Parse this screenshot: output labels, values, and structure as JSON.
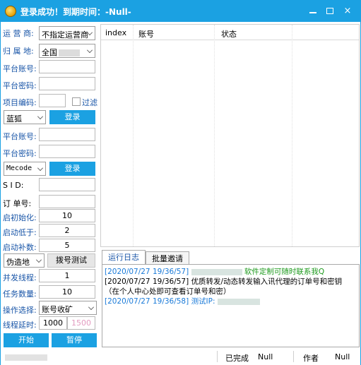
{
  "window": {
    "title": "登录成功！到期时间：-Null-",
    "minimize_label": "_",
    "maximize_label": "□",
    "close_label": "×"
  },
  "form": {
    "operator_label": "运 营 商:",
    "operator_value": "不指定运营商",
    "region_label": "归 属 地:",
    "region_value": "全国",
    "account1_label": "平台账号:",
    "password1_label": "平台密码:",
    "project_code_label": "项目编码:",
    "filter_label": "过滤",
    "platform1_value": "蓝狐",
    "login1_label": "登录",
    "account2_label": "平台账号:",
    "password2_label": "平台密码:",
    "platform2_value": "Mecode",
    "login2_label": "登录",
    "sid_label": "S  I  D:",
    "order_label": "订 单号:",
    "init_label": "启初始化:",
    "init_value": "10",
    "below_label": "启动低于:",
    "below_value": "2",
    "refill_label": "启动补数:",
    "refill_value": "5",
    "fake_location_value": "伪造地",
    "dial_test_label": "拨号测试",
    "threads_label": "并发线程:",
    "threads_value": "1",
    "task_count_label": "任务数量:",
    "task_count_value": "10",
    "operation_label": "操作选择:",
    "operation_value": "账号收矿",
    "delay_label": "线程延时:",
    "delay_min": "1000",
    "delay_max": "1500",
    "start_label": "开始",
    "pause_label": "暂停"
  },
  "grid": {
    "columns": [
      "index",
      "账号",
      "状态"
    ]
  },
  "tabs": [
    "运行日志",
    "批量邀请"
  ],
  "log": [
    {
      "time": "[2020/07/27  19/36/57]",
      "text": "软件定制可随时联系我Q",
      "color": "#1d9a1d"
    },
    {
      "time": "[2020/07/27  19/36/57]",
      "text": "优质转发/动态转发输入讯代理的订单号和密钥",
      "color": "#000000"
    },
    {
      "time": "",
      "text": "（在个人中心处即可查看订单号和密）",
      "color": "#000000"
    },
    {
      "time": "[2020/07/27  19/36/58]",
      "text": "测试IP:",
      "color": "#1a7ad8"
    }
  ],
  "status": {
    "completed_label": "已完成",
    "completed_value": "Null",
    "author_label": "作者",
    "author_value": "Null"
  },
  "colors": {
    "accent": "#1ba1e2",
    "label_blue": "#1a56a8"
  }
}
